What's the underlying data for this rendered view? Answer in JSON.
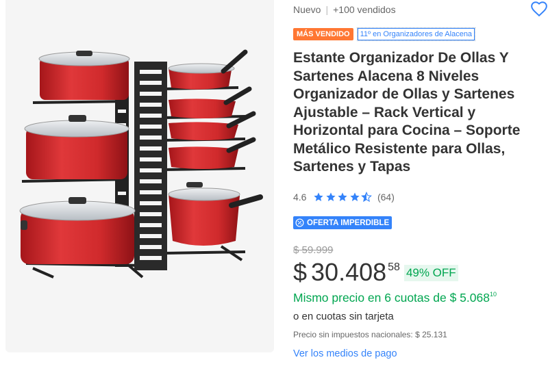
{
  "header": {
    "condition": "Nuevo",
    "separator": "|",
    "sold": "+100 vendidos",
    "favorite_icon": "heart-outline-icon"
  },
  "badges": {
    "best_seller": "MÁS VENDIDO",
    "ranking": "11º en Organizadores de Alacena"
  },
  "product": {
    "title": "Estante Organizador De Ollas Y Sartenes Alacena 8 Niveles Organizador de Ollas y Sartenes Ajustable – Rack Vertical y Horizontal para Cocina – Soporte Metálico Resistente para Ollas, Sartenes y Tapas"
  },
  "rating": {
    "score": "4.6",
    "stars_value": 4.6,
    "stars_max": 5,
    "reviews": "(64)"
  },
  "offer": {
    "label": "OFERTA IMPERDIBLE"
  },
  "pricing": {
    "old_price": "$ 59.999",
    "currency": "$",
    "amount": "30.408",
    "cents": "58",
    "discount": "49% OFF",
    "installments_text": "Mismo precio en 6 cuotas de $ 5.068",
    "installments_cents": "10",
    "no_card": "o en cuotas sin tarjeta",
    "tax_note": "Precio sin impuestos nacionales: $ 25.131",
    "payment_link": "Ver los medios de pago"
  },
  "colors": {
    "accent_blue": "#3483fa",
    "green": "#00a650",
    "orange": "#ff7733",
    "pot_red": "#d42a2a",
    "rack_black": "#222222"
  }
}
